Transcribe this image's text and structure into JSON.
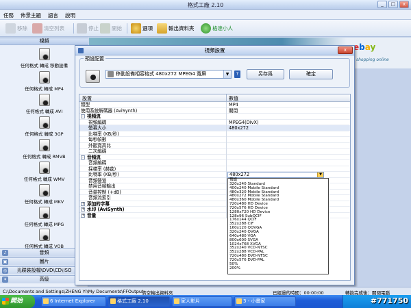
{
  "window": {
    "title": "格式工廠 2.10",
    "controls": [
      "_",
      "□",
      "x"
    ]
  },
  "menu": [
    "任務",
    "佈景主題",
    "語言",
    "說明"
  ],
  "toolbar": {
    "remove": "移除",
    "clear": "清空列表",
    "stop": "停止",
    "start": "開始",
    "options": "選項",
    "output": "輸出資料夾",
    "helper": "格達小人"
  },
  "sidebar": {
    "video_header": "視頻",
    "items": [
      {
        "label": "任何格式 轉成 移動設備"
      },
      {
        "label": "任何格式 轉成 MP4"
      },
      {
        "label": "任何格式 轉成 AVI"
      },
      {
        "label": "任何格式 轉成 3GP"
      },
      {
        "label": "任何格式 轉成 RMVB"
      },
      {
        "label": "任何格式 轉成 WMV"
      },
      {
        "label": "任何格式 轉成 MKV"
      },
      {
        "label": "任何格式 轉成 MPG"
      },
      {
        "label": "任何格式 轉成 VOB"
      }
    ],
    "sections": [
      "音頻",
      "圖片",
      "光碟裝設檔\\DVD\\CD\\ISO",
      "高級"
    ]
  },
  "banner": {
    "ebay": [
      "e",
      "b",
      "a",
      "y"
    ],
    "subtitle": "shopping online"
  },
  "dialog": {
    "title": "視頻設置",
    "preset_label": "預設配置",
    "preset_value": "移動設備相容格式 480x272 MPEG4 寬屏",
    "help": "?",
    "save_as": "另存爲",
    "ok": "確定",
    "col_setting": "設置",
    "col_value": "數值",
    "rows": [
      {
        "key": "類型",
        "value": "MP4"
      },
      {
        "key": "使用系統解碼器 (AviSynth)",
        "value": "關閉"
      },
      {
        "key": "視頻流",
        "value": "",
        "category": true,
        "toggle": "-"
      },
      {
        "key": "視頻編碼",
        "value": "MPEG4(DivX)",
        "indent": true
      },
      {
        "key": "螢幕大小",
        "value": "480x272",
        "indent": true,
        "selected": true
      },
      {
        "key": "比特率 (KB/秒)",
        "value": "",
        "indent": true
      },
      {
        "key": "每秒幀數",
        "value": "",
        "indent": true
      },
      {
        "key": "外觀寬高比",
        "value": "",
        "indent": true
      },
      {
        "key": "二次編碼",
        "value": "",
        "indent": true
      },
      {
        "key": "音頻流",
        "value": "",
        "category": true,
        "toggle": "-"
      },
      {
        "key": "音頻編碼",
        "value": "",
        "indent": true
      },
      {
        "key": "採樣率 (赫茲)",
        "value": "",
        "indent": true
      },
      {
        "key": "比特率 (KB/秒)",
        "value": "",
        "indent": true
      },
      {
        "key": "音頻聲道",
        "value": "",
        "indent": true
      },
      {
        "key": "禁用音頻輸出",
        "value": "",
        "indent": true
      },
      {
        "key": "音量控制 (+dB)",
        "value": "",
        "indent": true
      },
      {
        "key": "音頻流索引",
        "value": "",
        "indent": true
      },
      {
        "key": "添加的字幕",
        "value": "",
        "category": true,
        "toggle": "+"
      },
      {
        "key": "水印 (AviSynth)",
        "value": "",
        "category": true,
        "toggle": "+"
      },
      {
        "key": "音量",
        "value": "",
        "category": true,
        "toggle": "+"
      }
    ],
    "dropdown": {
      "current": "480x272",
      "options": [
        "預設",
        "320x240 Standard",
        "400x240 Mobile Standard",
        "480x320 Mobile Standard",
        "480x272 Mobile Standard",
        "480x360 Mobile Standard",
        "720x480 HD Device",
        "720x576 HD Device",
        "1280x720 HD Device",
        "128x96 SubQCIF",
        "176x144 QCIF",
        "352x288 CIF",
        "160x120 QQVGA",
        "320x240 QVGA",
        "640x480 VGA",
        "800x600 SVGA",
        "1024x768 XVGA",
        "352x240 VCD-NTSC",
        "352x288 VCD-PAL",
        "720x480 DVD-NTSC",
        "720x576 DVD-PAL",
        "50%",
        "200%"
      ]
    }
  },
  "statusbar": {
    "path": "C:\\Documents and Settings\\ZHENG YI\\My Documents\\FFOutput",
    "output_folder": "清空輸出資料夾",
    "elapsed": "已經過的時間：00:00:00",
    "after_done": "轉換完成後：關閉電腦"
  },
  "taskbar": {
    "start": "開始",
    "tasks": [
      "6 Internet Explorer",
      "格式工廠 2.10",
      "家人影片",
      "3 - 小畫家"
    ],
    "watermark": "#771750"
  }
}
